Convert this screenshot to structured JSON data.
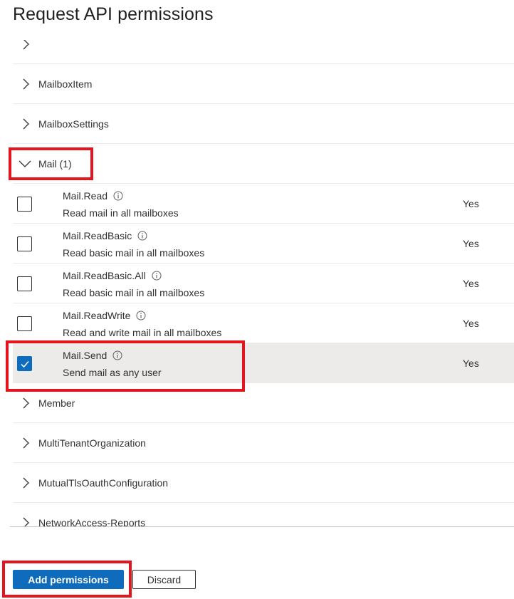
{
  "page": {
    "title": "Request API permissions"
  },
  "groups_top": [
    {
      "label": "MailboxItem",
      "expanded": false
    },
    {
      "label": "MailboxSettings",
      "expanded": false
    },
    {
      "label": "Mail (1)",
      "expanded": true
    }
  ],
  "permissions": [
    {
      "name": "Mail.Read",
      "description": "Read mail in all mailboxes",
      "admin_consent": "Yes",
      "checked": false
    },
    {
      "name": "Mail.ReadBasic",
      "description": "Read basic mail in all mailboxes",
      "admin_consent": "Yes",
      "checked": false
    },
    {
      "name": "Mail.ReadBasic.All",
      "description": "Read basic mail in all mailboxes",
      "admin_consent": "Yes",
      "checked": false
    },
    {
      "name": "Mail.ReadWrite",
      "description": "Read and write mail in all mailboxes",
      "admin_consent": "Yes",
      "checked": false
    },
    {
      "name": "Mail.Send",
      "description": "Send mail as any user",
      "admin_consent": "Yes",
      "checked": true
    }
  ],
  "groups_bottom": [
    {
      "label": "Member",
      "expanded": false
    },
    {
      "label": "MultiTenantOrganization",
      "expanded": false
    },
    {
      "label": "MutualTlsOauthConfiguration",
      "expanded": false
    },
    {
      "label": "NetworkAccess-Reports",
      "expanded": false
    }
  ],
  "footer": {
    "add_label": "Add permissions",
    "discard_label": "Discard"
  },
  "colors": {
    "accent": "#0f6cbd",
    "highlight": "#e3161f",
    "selected_row": "#edebe9"
  },
  "icons": [
    "chevron-right-icon",
    "chevron-down-icon",
    "info-icon",
    "checkmark-icon"
  ]
}
